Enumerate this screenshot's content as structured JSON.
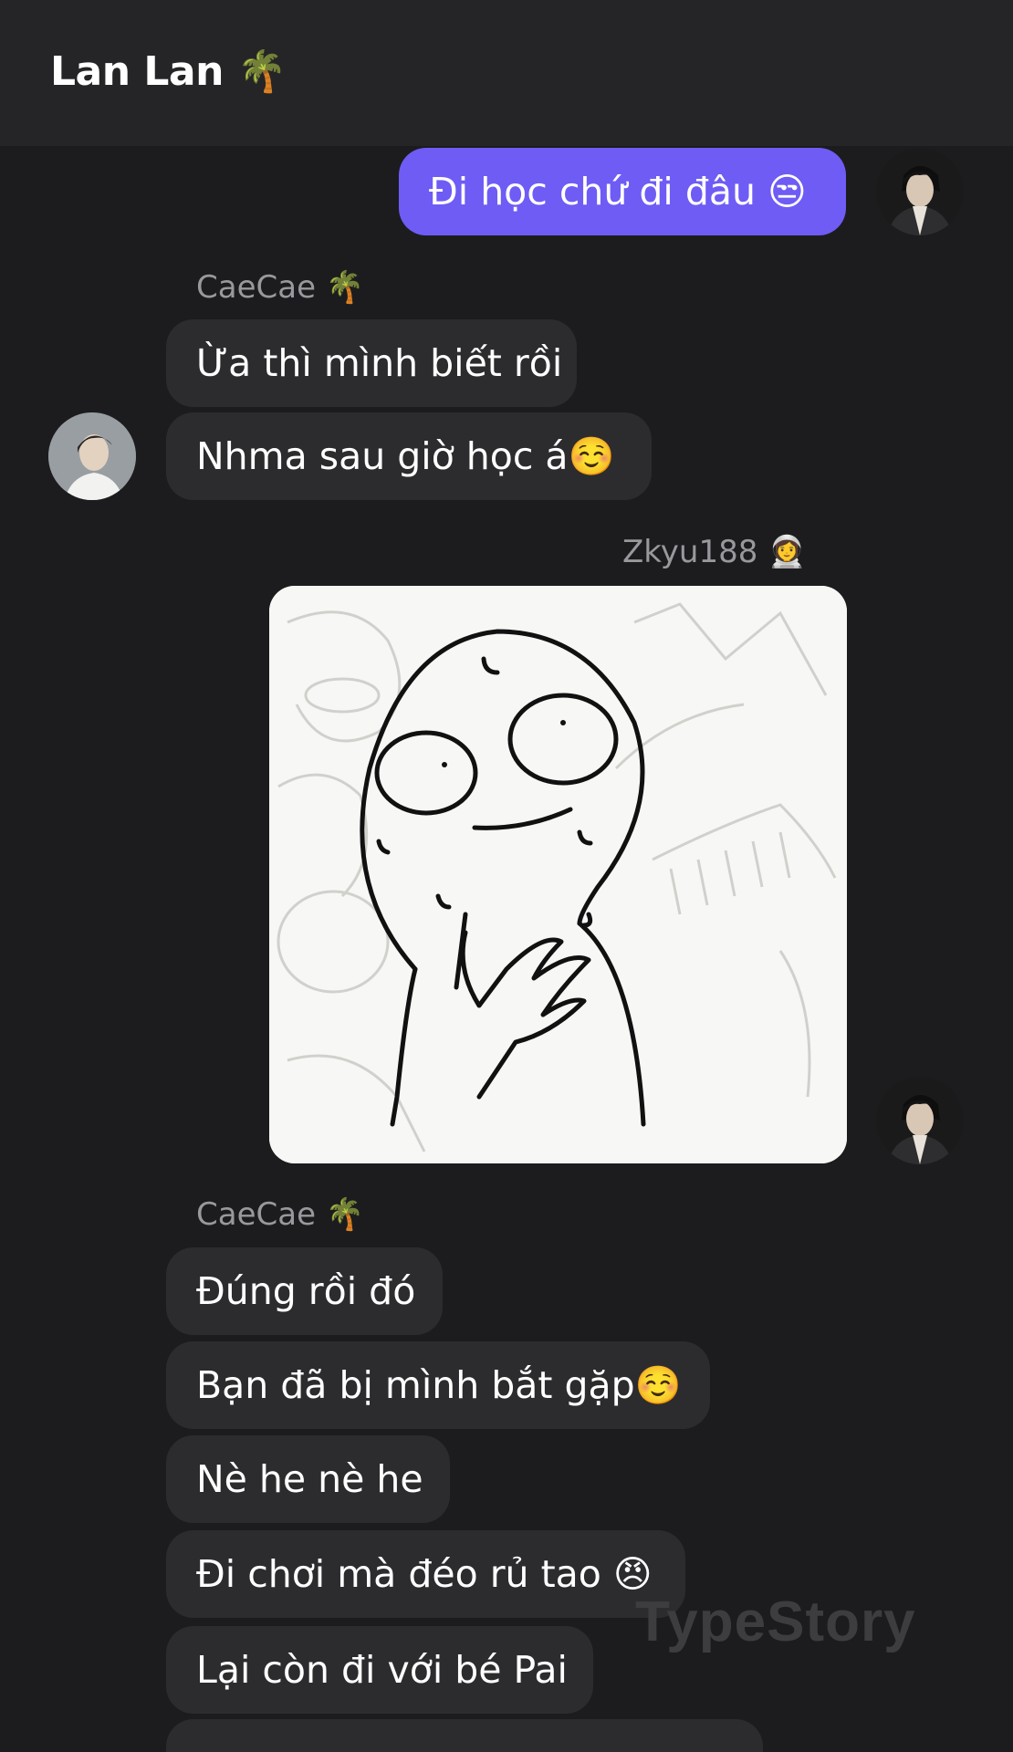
{
  "header": {
    "title": "Lan Lan 🌴"
  },
  "messages": [
    {
      "text": "Đi học chứ đi đâu 😒"
    },
    {
      "sender": "CaeCae 🌴"
    },
    {
      "text": "Ừa thì mình biết rồi"
    },
    {
      "text": "Nhma sau giờ học á☺️"
    },
    {
      "sender": "Zkyu188 👩‍🚀"
    },
    {
      "sender": "CaeCae 🌴"
    },
    {
      "text": "Đúng rồi đó"
    },
    {
      "text": "Bạn đã bị mình bắt gặp☺️"
    },
    {
      "text": "Nè he nè he"
    },
    {
      "text": "Đi chơi mà đéo rủ tao 😠"
    },
    {
      "text": "Lại còn đi với bé Pai"
    }
  ],
  "watermark": "TypeStory",
  "colors": {
    "background": "#1c1c1e",
    "header": "#252527",
    "incoming_bubble": "#2c2c2e",
    "outgoing_bubble": "#6e5cf5",
    "sender_name": "#98989d"
  }
}
